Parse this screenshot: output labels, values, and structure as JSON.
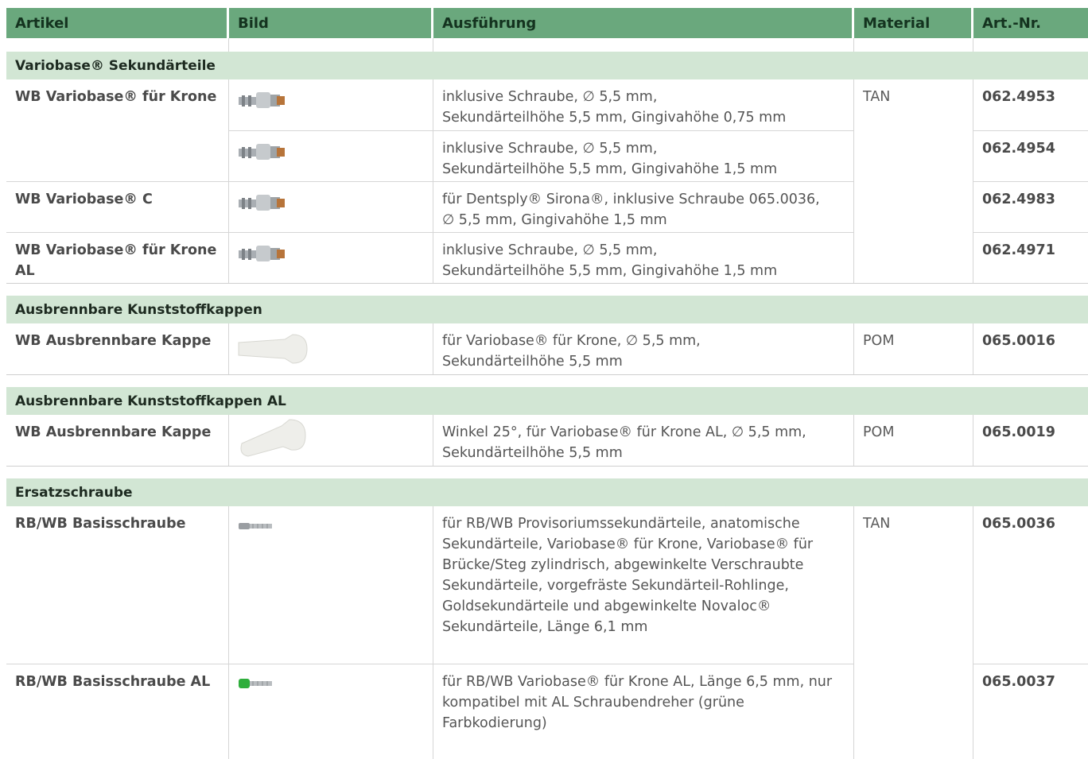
{
  "header": [
    "Artikel",
    "Bild",
    "Ausführung",
    "Material",
    "Art.-Nr."
  ],
  "sections": [
    {
      "title": "Variobase® Sekundärteile",
      "rows": [
        {
          "artikel": "WB Variobase® für Krone",
          "bild": "abutment-image",
          "ausf": [
            "inklusive Schraube, ∅ 5,5 mm,",
            "Sekundärteilhöhe 5,5 mm, Gingivahöhe 0,75 mm"
          ],
          "material": "TAN",
          "nr": "062.4953"
        },
        {
          "artikel": "",
          "bild": "abutment-image",
          "ausf": [
            "inklusive Schraube, ∅ 5,5 mm,",
            "Sekundärteilhöhe 5,5 mm, Gingivahöhe 1,5 mm"
          ],
          "material": "",
          "nr": "062.4954"
        },
        {
          "artikel": "WB Variobase® C",
          "bild": "abutment-image",
          "ausf": [
            "für Dentsply® Sirona®, inklusive Schraube 065.0036,",
            "∅ 5,5 mm, Gingivahöhe 1,5 mm"
          ],
          "material": "",
          "nr": "062.4983"
        },
        {
          "artikel": "WB Variobase® für Krone AL",
          "bild": "abutment-image",
          "ausf": [
            "inklusive Schraube, ∅ 5,5 mm,",
            "Sekundärteilhöhe 5,5 mm, Gingivahöhe 1,5 mm"
          ],
          "material": "",
          "nr": "062.4971"
        }
      ]
    },
    {
      "title": "Ausbrennbare Kunststoffkappen",
      "rows": [
        {
          "artikel": "WB Ausbrennbare Kappe",
          "bild": "cap-image",
          "ausf": [
            "für Variobase® für Krone, ∅ 5,5 mm,",
            "Sekundärteilhöhe 5,5 mm"
          ],
          "material": "POM",
          "nr": "065.0016"
        }
      ]
    },
    {
      "title": "Ausbrennbare Kunststoffkappen AL",
      "rows": [
        {
          "artikel": "WB Ausbrennbare Kappe",
          "bild": "angled-cap-image",
          "ausf": [
            "Winkel 25°, für Variobase® für Krone AL, ∅ 5,5 mm,",
            "Sekundärteilhöhe 5,5 mm"
          ],
          "material": "POM",
          "nr": "065.0019"
        }
      ]
    },
    {
      "title": "Ersatzschraube",
      "rows": [
        {
          "artikel": "RB/WB Basisschraube",
          "bild": "screw-image",
          "ausf": [
            "für RB/WB Provisoriumssekundärteile, anatomische",
            "Sekundärteile, Variobase® für Krone, Variobase® für",
            "Brücke/Steg zylindrisch, abgewinkelte Verschraubte",
            "Sekundärteile, vorgefräste Sekundärteil-Rohlinge,",
            "Goldsekundärteile und abgewinkelte Novaloc®",
            "Sekundärteile, Länge 6,1 mm"
          ],
          "material": "TAN",
          "nr": "065.0036"
        },
        {
          "artikel": "RB/WB Basisschraube AL",
          "bild": "green-screw-image",
          "ausf": [
            "für RB/WB Variobase® für Krone AL, Länge 6,5 mm, nur",
            "kompatibel mit AL Schraubendreher (grüne",
            "Farbkodierung)"
          ],
          "material": "",
          "nr": "065.0037"
        }
      ]
    }
  ]
}
